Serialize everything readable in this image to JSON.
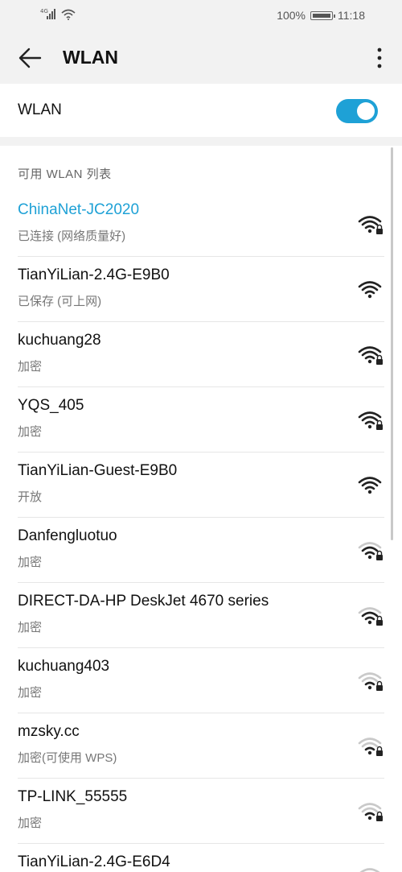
{
  "status_bar": {
    "network_type": "4G",
    "battery_percent": "100%",
    "time": "11:18"
  },
  "app_bar": {
    "title": "WLAN"
  },
  "wlan_toggle": {
    "label": "WLAN",
    "enabled": true,
    "accent_color": "#1ea1d6"
  },
  "available_list": {
    "header": "可用 WLAN 列表",
    "networks": [
      {
        "ssid": "ChinaNet-JC2020",
        "status": "已连接 (网络质量好)",
        "connected": true,
        "locked": true,
        "strength": 4
      },
      {
        "ssid": "TianYiLian-2.4G-E9B0",
        "status": "已保存 (可上网)",
        "connected": false,
        "locked": false,
        "strength": 4
      },
      {
        "ssid": "kuchuang28",
        "status": "加密",
        "connected": false,
        "locked": true,
        "strength": 4
      },
      {
        "ssid": "YQS_405",
        "status": "加密",
        "connected": false,
        "locked": true,
        "strength": 4
      },
      {
        "ssid": "TianYiLian-Guest-E9B0",
        "status": "开放",
        "connected": false,
        "locked": false,
        "strength": 4
      },
      {
        "ssid": "Danfengluotuo",
        "status": "加密",
        "connected": false,
        "locked": true,
        "strength": 3
      },
      {
        "ssid": "DIRECT-DA-HP DeskJet 4670 series",
        "status": "加密",
        "connected": false,
        "locked": true,
        "strength": 3
      },
      {
        "ssid": "kuchuang403",
        "status": "加密",
        "connected": false,
        "locked": true,
        "strength": 2
      },
      {
        "ssid": "mzsky.cc",
        "status": "加密(可使用 WPS)",
        "connected": false,
        "locked": true,
        "strength": 2
      },
      {
        "ssid": "TP-LINK_55555",
        "status": "加密",
        "connected": false,
        "locked": true,
        "strength": 2
      },
      {
        "ssid": "TianYiLian-2.4G-E6D4",
        "status": "",
        "connected": false,
        "locked": true,
        "strength": 2
      }
    ]
  }
}
